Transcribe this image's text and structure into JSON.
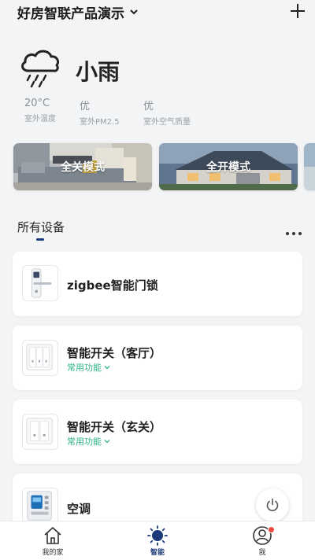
{
  "header": {
    "home_name": "好房智联产品演示"
  },
  "weather": {
    "condition": "小雨",
    "stats": [
      {
        "value": "20°C",
        "label": "室外温度"
      },
      {
        "value": "优",
        "label": "室外PM2.5"
      },
      {
        "value": "优",
        "label": "室外空气质量"
      }
    ]
  },
  "scenes": [
    {
      "label": "全关模式"
    },
    {
      "label": "全开模式"
    }
  ],
  "devices_section": {
    "title": "所有设备"
  },
  "devices": [
    {
      "name": "zigbee智能门锁"
    },
    {
      "name": "智能开关（客厅）",
      "sub": "常用功能"
    },
    {
      "name": "智能开关（玄关）",
      "sub": "常用功能"
    },
    {
      "name": "空调"
    }
  ],
  "nav": {
    "items": [
      {
        "label": "我的家"
      },
      {
        "label": "智能"
      },
      {
        "label": "我"
      }
    ]
  },
  "colors": {
    "accent": "#1b3b7a",
    "sub_link": "#2fb48a",
    "badge": "#e94a3f"
  }
}
